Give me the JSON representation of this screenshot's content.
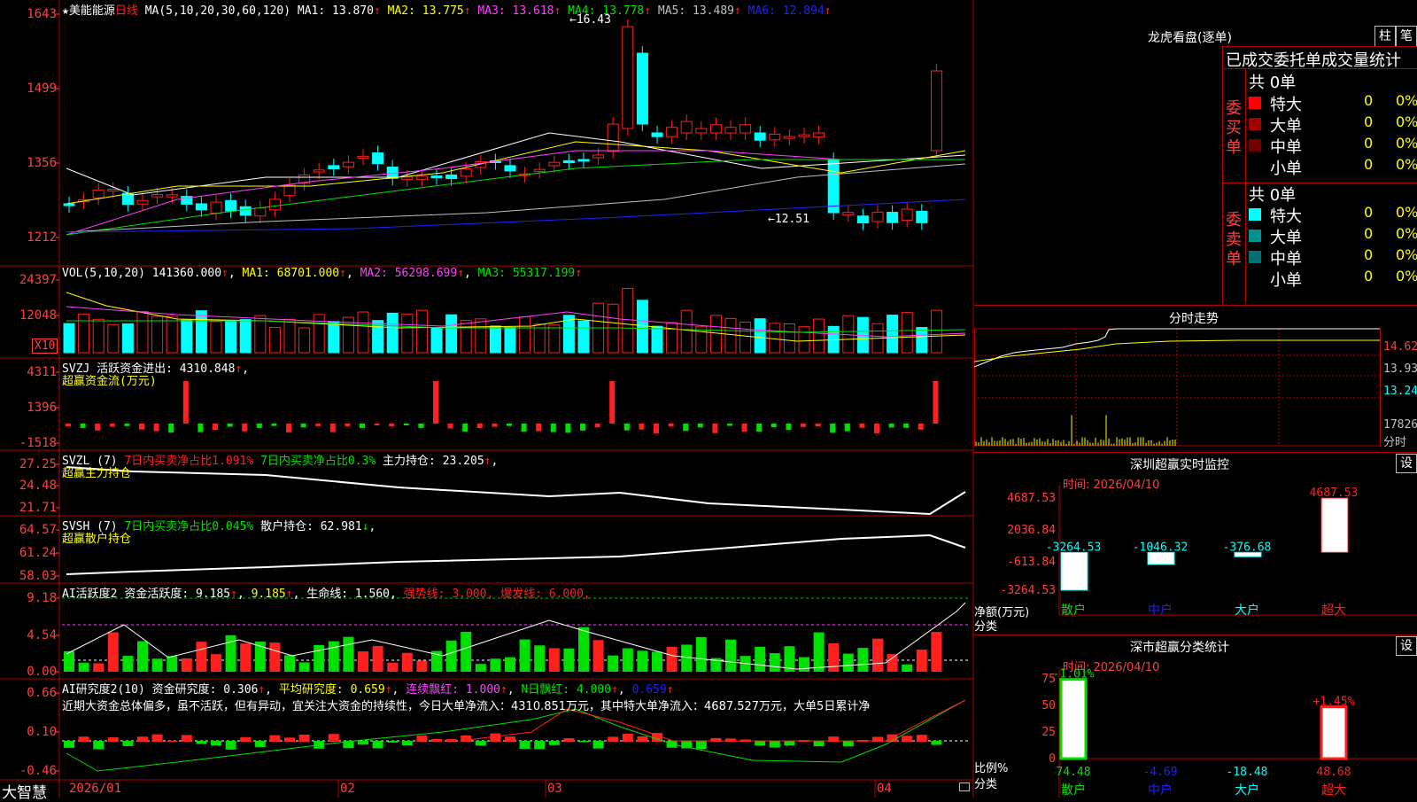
{
  "stock": {
    "name": "美能能源",
    "period": "日线",
    "star": "★"
  },
  "colors": {
    "up": "#ff2020",
    "down": "#00ffff",
    "frame": "#b00000",
    "green": "#00e000",
    "magenta": "#ff40ff",
    "yellow": "#ffff00",
    "white": "#ffffff"
  },
  "price": {
    "axis_labels": [
      "1643",
      "1499",
      "1356",
      "1212"
    ],
    "ma_header": "MA(5,10,20,30,60,120)",
    "ma": [
      {
        "label": "MA1:",
        "value": "13.870",
        "color": "#ffffff"
      },
      {
        "label": "MA2:",
        "value": "13.775",
        "color": "#ffff00"
      },
      {
        "label": "MA3:",
        "value": "13.618",
        "color": "#ff40ff"
      },
      {
        "label": "MA4:",
        "value": "13.778",
        "color": "#00e000"
      },
      {
        "label": "MA5:",
        "value": "13.489",
        "color": "#c0c0c0"
      },
      {
        "label": "MA6:",
        "value": "12.894",
        "color": "#2020ff"
      }
    ],
    "high_marker": "←16.43",
    "low_marker": "←12.51"
  },
  "volume": {
    "axis_labels": [
      "24397",
      "12048"
    ],
    "unit": "X10",
    "header": "VOL(5,10,20)",
    "value": "141360.000",
    "ma1": "68701.000",
    "ma2": "56298.699",
    "ma3": "55317.199"
  },
  "svzj": {
    "axis_labels": [
      "4311",
      "1396",
      "-1518"
    ],
    "header": "SVZJ",
    "label": "活跃资金进出:",
    "value": "4310.848",
    "subtitle": "超赢资金流(万元)"
  },
  "svzl": {
    "axis_labels": [
      "27.25",
      "24.48",
      "21.71"
    ],
    "header": "SVZL (7)",
    "buy_ratio": "7日内买卖净占比1.091%",
    "buy_ratio2": "7日内买卖净占比0.3%",
    "hold_label": "主力持仓:",
    "hold_value": "23.205",
    "subtitle": "超赢主力持仓"
  },
  "svsh": {
    "axis_labels": [
      "64.57",
      "61.24",
      "58.03"
    ],
    "header": "SVSH (7)",
    "ratio": "7日内买卖净占比0.045%",
    "hold_label": "散户持仓:",
    "hold_value": "62.981",
    "subtitle": "超赢散户持仓"
  },
  "ai_active": {
    "axis_labels": [
      "9.18",
      "4.54",
      "0.00"
    ],
    "header": "AI活跃度2",
    "label": "资金活跃度:",
    "value": "9.185",
    "value2": "9.185",
    "life_label": "生命线:",
    "life_value": "1.560,",
    "strong": "强势线: 3.000,",
    "burst": "爆发线: 6.000,"
  },
  "ai_research": {
    "axis_labels": [
      "0.66",
      "0.10",
      "-0.46"
    ],
    "header": "AI研究度2(10)",
    "label": "资金研究度:",
    "value": "0.306",
    "avg_label": "平均研究度:",
    "avg_value": "0.659",
    "red_label": "连续飘红:",
    "red_value": "1.000",
    "nred_label": "N日飘红:",
    "nred_value": "4.000",
    "last_value": "0.659",
    "comment": "近期大资金总体偏多，虽不活跃，但有异动，宜关注大资金的持续性，今日大单净流入：4310.851万元，其中特大单净流入：4687.527万元，大单5日累计净"
  },
  "dates": [
    "2026/01",
    "02",
    "03",
    "04"
  ],
  "brand": "大智慧",
  "right": {
    "title": "龙虎看盘(逐单)",
    "btn1": "柱",
    "btn2": "笔",
    "stat_title": "已成交委托单成交量统计",
    "buy_side": "委买单",
    "sell_side": "委卖单",
    "buy_total": "共 0单",
    "sell_total": "共 0单",
    "buy_rows": [
      {
        "name": "特大",
        "count": "0",
        "pct": "0%",
        "color": "#ff0000"
      },
      {
        "name": "大单",
        "count": "0",
        "pct": "0%",
        "color": "#a00000"
      },
      {
        "name": "中单",
        "count": "0",
        "pct": "0%",
        "color": "#700000"
      },
      {
        "name": "小单",
        "count": "0",
        "pct": "0%",
        "color": "#000000"
      }
    ],
    "sell_rows": [
      {
        "name": "特大",
        "count": "0",
        "pct": "0%",
        "color": "#00ffff"
      },
      {
        "name": "大单",
        "count": "0",
        "pct": "0%",
        "color": "#009090"
      },
      {
        "name": "中单",
        "count": "0",
        "pct": "0%",
        "color": "#007070"
      },
      {
        "name": "小单",
        "count": "0",
        "pct": "0%",
        "color": "#000000"
      }
    ],
    "intraday_title": "分时走势",
    "intraday_axis": [
      "14.62",
      "13.93",
      "13.24",
      "17826",
      "分时"
    ],
    "monitor_title": "深圳超赢实时监控",
    "monitor_btn": "设",
    "monitor_time": "时间: 2026/04/10",
    "monitor_axis": [
      "4687.53",
      "2036.84",
      "-613.84",
      "-3264.53"
    ],
    "monitor_unit": "净额(万元)",
    "monitor_class": "分类",
    "classify_title": "深市超赢分类统计",
    "classify_btn": "设",
    "classify_time": "时间: 2026/04/10",
    "classify_axis": [
      "75",
      "50",
      "25",
      "0"
    ],
    "classify_unit": "比例%",
    "classify_class": "分类",
    "categories": [
      "散户",
      "中户",
      "大户",
      "超大"
    ]
  },
  "chart_data": [
    {
      "type": "bar",
      "title": "深圳超赢实时监控",
      "ylabel": "净额(万元)",
      "categories": [
        "散户",
        "中户",
        "大户",
        "超大"
      ],
      "values": [
        -3264.53,
        -1046.32,
        -376.68,
        4687.53
      ],
      "value_labels": [
        "-3264.53",
        "-1046.32",
        "-376.68",
        "4687.53"
      ],
      "ylim": [
        -3264.53,
        4687.53
      ]
    },
    {
      "type": "bar",
      "title": "深市超赢分类统计",
      "ylabel": "比例%",
      "categories": [
        "散户",
        "中户",
        "大户",
        "超大"
      ],
      "values": [
        74.48,
        -4.69,
        -18.48,
        48.68
      ],
      "changes": [
        "-1.01%",
        "",
        "",
        "+1.45%"
      ],
      "value_labels": [
        "74.48",
        "-4.69",
        "-18.48",
        "48.68"
      ],
      "ylim": [
        0,
        75
      ]
    }
  ]
}
